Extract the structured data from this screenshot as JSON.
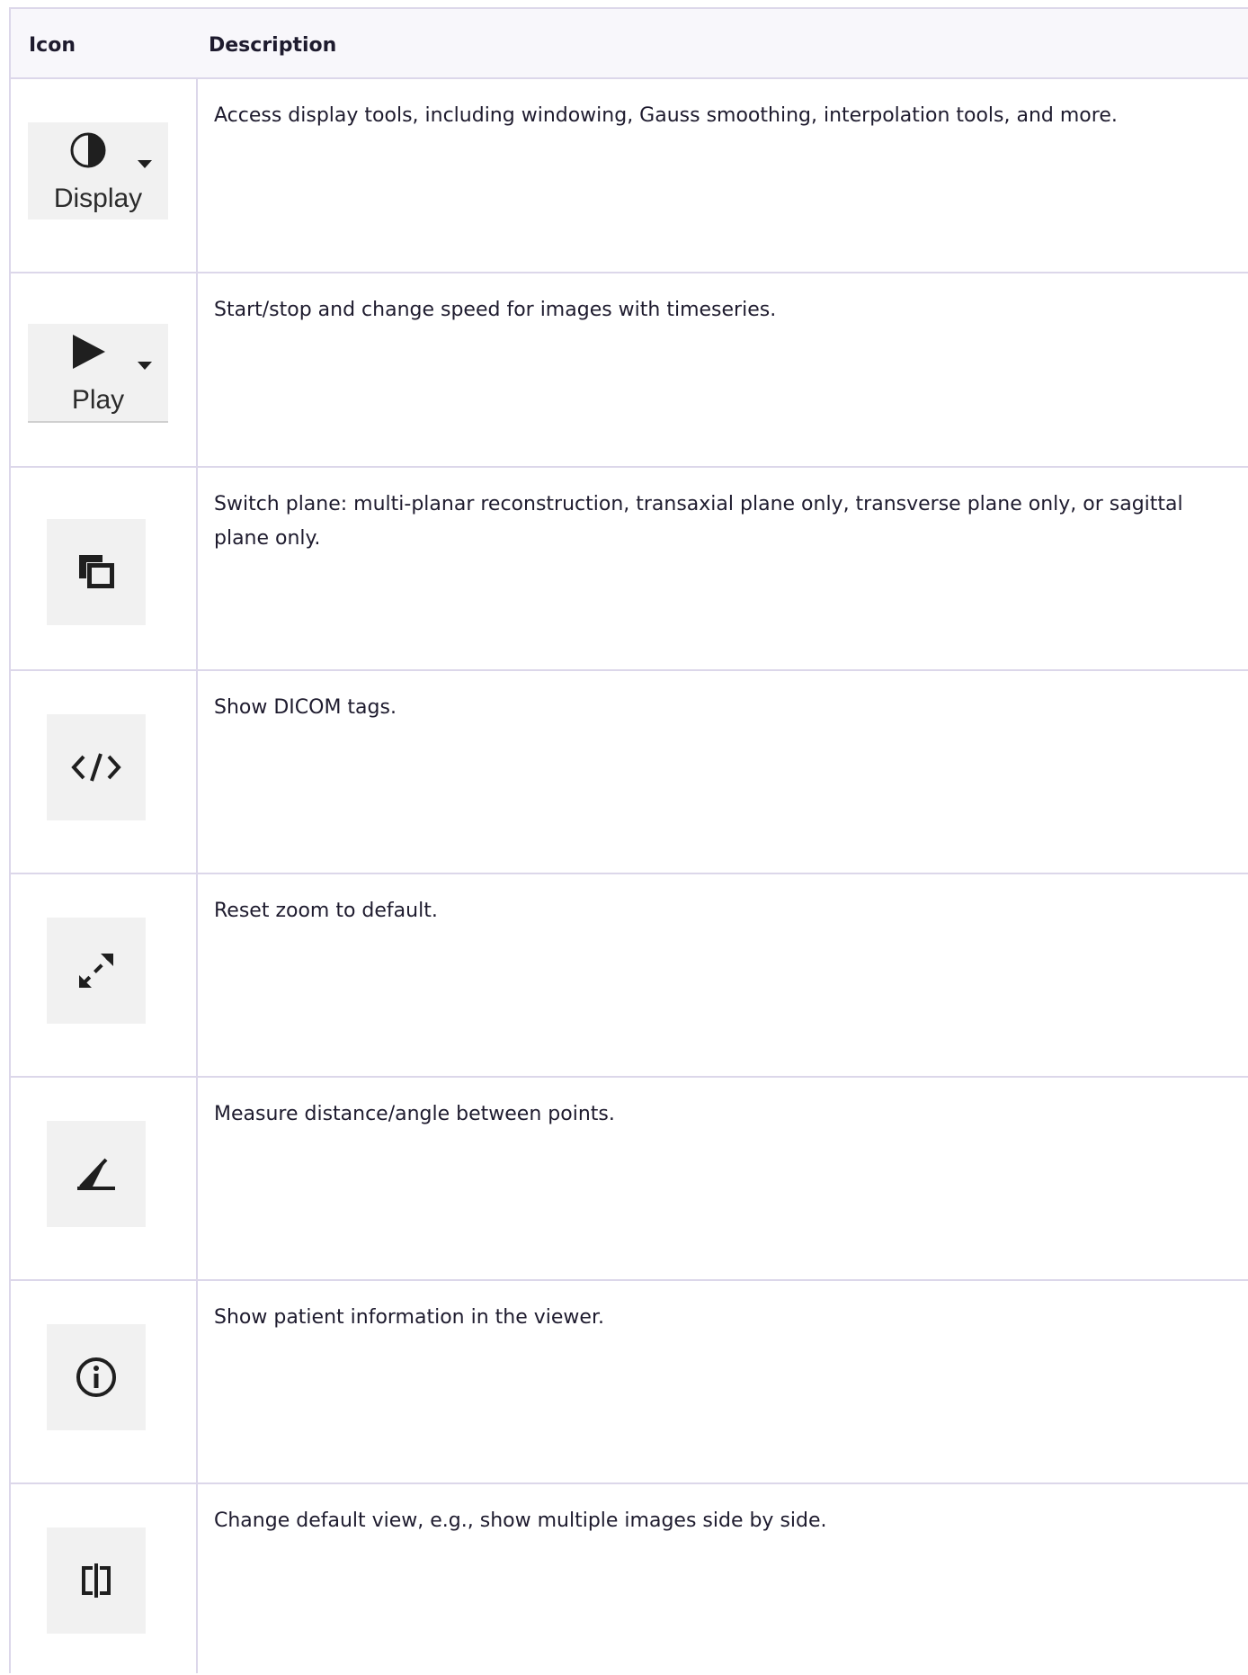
{
  "header": {
    "icon_col": "Icon",
    "desc_col": "Description"
  },
  "rows": [
    {
      "icon": "display-contrast-icon",
      "label": "Display",
      "desc": "Access display tools, including windowing, Gauss smoothing, interpolation tools, and more."
    },
    {
      "icon": "play-icon",
      "label": "Play",
      "desc": "Start/stop and change speed for images with timeseries."
    },
    {
      "icon": "switch-plane-icon",
      "desc": "Switch plane: multi-planar reconstruction, transaxial plane only, transverse plane only, or sagittal plane only."
    },
    {
      "icon": "code-tags-icon",
      "desc": "Show DICOM tags."
    },
    {
      "icon": "resize-arrows-icon",
      "desc": "Reset zoom to default."
    },
    {
      "icon": "angle-measure-icon",
      "desc": "Measure distance/angle between points."
    },
    {
      "icon": "info-icon",
      "desc": "Show patient information in the viewer."
    },
    {
      "icon": "split-view-icon",
      "desc": "Change default view, e.g., show multiple images side by side."
    }
  ],
  "colors": {
    "border": "#dcd7ea",
    "header_bg": "#f8f7fb",
    "tile_bg": "#f1f1f1",
    "text": "#1e1b2e"
  }
}
